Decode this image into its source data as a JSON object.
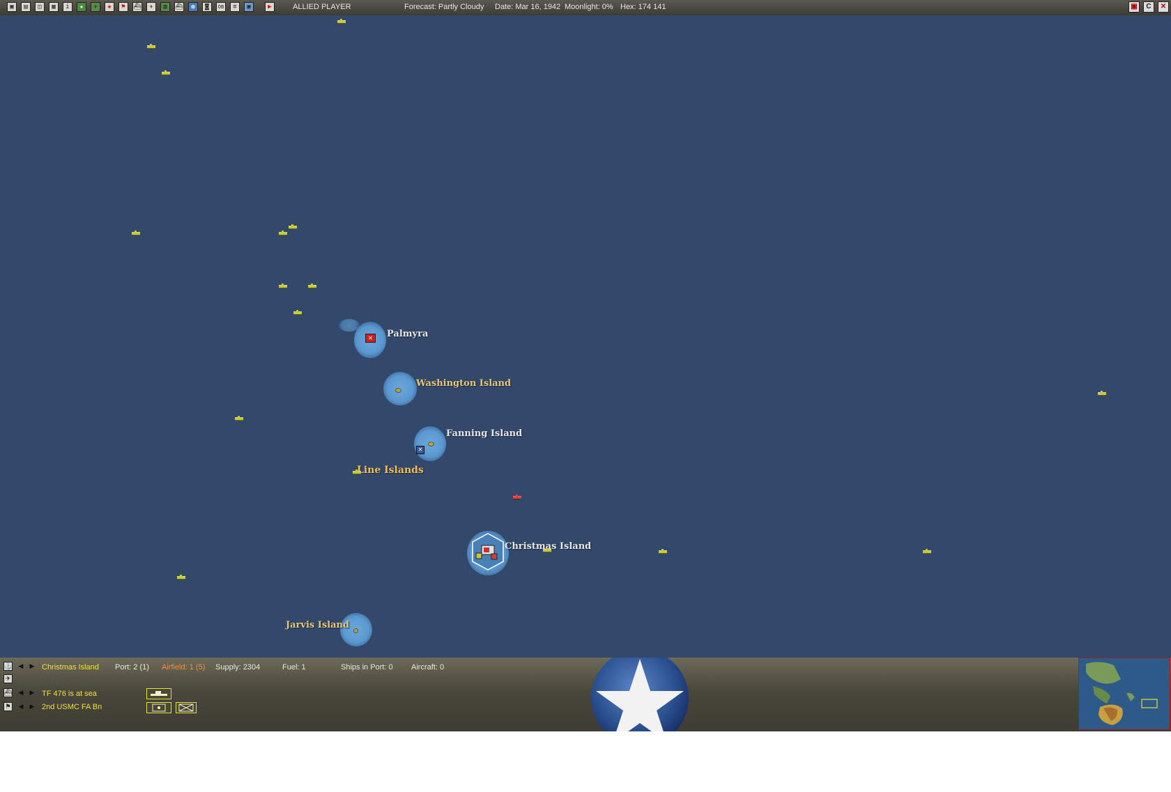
{
  "topbar": {
    "player": "ALLIED PLAYER",
    "forecast": "Forecast: Partly Cloudy",
    "date": "Date: Mar 16, 1942",
    "moonlight": "Moonlight: 0%",
    "hex": "Hex: 174 141",
    "icons": [
      "save-icon",
      "report-icon",
      "unit-list-icon",
      "ship-list-icon",
      "info-icon",
      "star-icon",
      "aircraft-icon",
      "red-cross-icon",
      "flag-icon",
      "ship-icon",
      "airgroup-icon",
      "base-icon",
      "sub-icon",
      "globe-icon",
      "camera-icon",
      "ob-icon",
      "list-icon",
      "map-icon",
      "end-turn-icon"
    ],
    "icon_glyphs": [
      "▣",
      "▤",
      "◫",
      "▦",
      "i",
      "★",
      "✈",
      "✚",
      "⚑",
      "⛴",
      "✈",
      "▥",
      "⛴",
      "◍",
      "◙",
      "OB",
      "≡",
      "▣",
      "▶"
    ],
    "window_buttons": [
      "▣",
      "C",
      "✕"
    ]
  },
  "map": {
    "places": [
      {
        "name": "Palmyra",
        "color": "#e6e6e6"
      },
      {
        "name": "Washington Island",
        "color": "#e8c878"
      },
      {
        "name": "Fanning Island",
        "color": "#e6e6e6"
      },
      {
        "name": "Christmas Island",
        "color": "#e6e6e6"
      },
      {
        "name": "Jarvis Island",
        "color": "#e8c878"
      }
    ],
    "region": "Line Islands",
    "base_marker_glyph": "✕"
  },
  "panel": {
    "base_name": "Christmas Island",
    "port": "Port: 2 (1)",
    "airfield": "Airfield: 1 (5)",
    "supply": "Supply: 2304",
    "fuel": "Fuel: 1",
    "ships_in_port": "Ships in Port: 0",
    "aircraft": "Aircraft: 0",
    "tf_status": "TF 476 is at sea",
    "unit_name": "2nd USMC FA Bn",
    "colors": {
      "base_name": "#f0e040",
      "airfield": "#f09040",
      "unit_text": "#f0e040"
    },
    "left_icons": [
      "anchor-icon",
      "plane-icon",
      "ship-icon",
      "flag-icon"
    ],
    "left_glyphs": [
      "⚓",
      "✈",
      "⛴",
      "⚑"
    ],
    "arrow_left": "◀",
    "arrow_right": "▶"
  }
}
